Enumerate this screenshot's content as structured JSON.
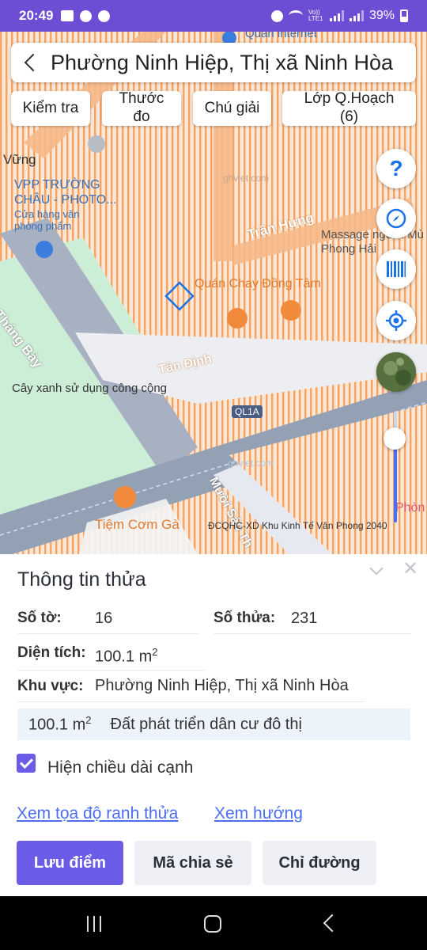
{
  "status_bar": {
    "time": "20:49",
    "notification_icons": [
      "image-icon",
      "cloud-icon",
      "facebook-icon"
    ],
    "right_icons": [
      "alarm-icon",
      "wifi-icon",
      "volte-icon",
      "signal-icon",
      "signal-icon"
    ],
    "volte_label": "Vo)) LTE1",
    "battery": "39%"
  },
  "header": {
    "title": "Phường Ninh Hiệp, Thị xã Ninh Hòa",
    "back_icon": "chevron-left-icon"
  },
  "toolbar": {
    "check_label": "Kiểm tra",
    "measure_label": "Thước đo",
    "legend_label": "Chú giải",
    "layer_label": "Lớp Q.Hoạch (6)"
  },
  "map": {
    "labels": {
      "internet": "Quán internet",
      "vung": "Vững",
      "vpp": "VPP TRƯỜNG CHÂU - PHOTO...",
      "store_type": "Cửa hàng văn phòng phẩm",
      "tran_hung": "Trần Hưng",
      "massage": "Massage người Mù Phong Hải",
      "quan_chay": "Quán Chay Đồng Tâm",
      "thang_bay": "Tháng Bảy",
      "tan_dinh": "Tân Định",
      "cay_xanh": "Cây xanh sử dụng công cộng",
      "ql1a": "QL1A",
      "muoi_sau": "Mười Sáu Th",
      "tiem_com": "Tiệm Cơm Gà",
      "phong": "Phòn"
    },
    "watermark": "ghvlet.com",
    "attribution": "ĐCQHC-XD Khu Kinh Tế Vân Phong 2040",
    "controls": [
      "help-icon",
      "compass-icon",
      "barcode-icon",
      "my-location-icon",
      "satellite-layer-icon"
    ],
    "help_glyph": "?",
    "colors": {
      "planning_orange": "#f28a3c",
      "road": "#9aa6b8",
      "park_green": "#c9ecd2",
      "parcel_blue": "#1a73e8"
    }
  },
  "panel": {
    "title": "Thông tin thửa",
    "close_glyph": "✕",
    "sheet_label": "Số tờ:",
    "sheet_value": "16",
    "parcel_label": "Số thửa:",
    "parcel_value": "231",
    "area_label": "Diện tích:",
    "area_value": "100.1 m",
    "area_unit_sup": "2",
    "region_label": "Khu vực:",
    "region_value": "Phường Ninh Hiệp, Thị xã Ninh Hòa",
    "landuse_area": "100.1 m",
    "landuse_area_sup": "2",
    "landuse_type": "Đất phát triển dân cư đô thị",
    "show_edges_label": "Hiện chiều dài cạnh",
    "show_edges_checked": true,
    "link_coords": "Xem tọa độ ranh thửa",
    "link_direction": "Xem hướng",
    "btn_save": "Lưu điểm",
    "btn_share": "Mã chia sẻ",
    "btn_route": "Chỉ đường"
  },
  "nav": {
    "icons": [
      "recents-icon",
      "home-icon",
      "back-icon"
    ]
  }
}
